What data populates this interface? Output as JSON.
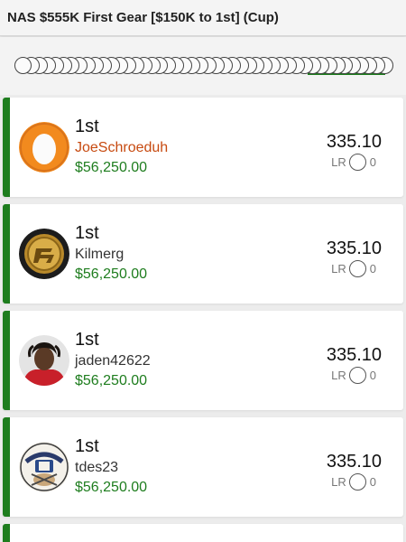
{
  "header": {
    "title": "NAS $555K First Gear [$150K to 1st] (Cup)"
  },
  "avatar_strip": {
    "count": 46
  },
  "entries": [
    {
      "rank": "1st",
      "username": "JoeSchroeduh",
      "prize": "$56,250.00",
      "score": "335.10",
      "lr_label": "LR",
      "lr_value": "0",
      "avatar_icon": "egg-avatar-icon",
      "highlight": true
    },
    {
      "rank": "1st",
      "username": "Kilmerg",
      "prize": "$56,250.00",
      "score": "335.10",
      "lr_label": "LR",
      "lr_value": "0",
      "avatar_icon": "gold-coin-avatar-icon",
      "highlight": false
    },
    {
      "rank": "1st",
      "username": "jaden42622",
      "prize": "$56,250.00",
      "score": "335.10",
      "lr_label": "LR",
      "lr_value": "0",
      "avatar_icon": "person-photo-avatar-icon",
      "highlight": false
    },
    {
      "rank": "1st",
      "username": "tdes23",
      "prize": "$56,250.00",
      "score": "335.10",
      "lr_label": "LR",
      "lr_value": "0",
      "avatar_icon": "dfsarmy-logo-avatar-icon",
      "highlight": false
    }
  ],
  "colors": {
    "accent_green": "#1e7d1e",
    "highlight_orange": "#c74a10",
    "egg_bg": "#f28a1e"
  }
}
